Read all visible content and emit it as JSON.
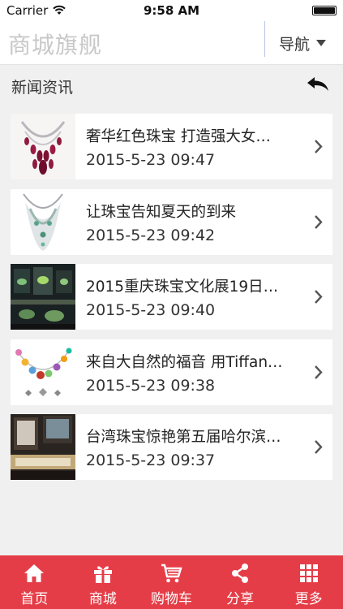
{
  "status_bar": {
    "carrier": "Carrier",
    "time": "9:58 AM"
  },
  "header": {
    "title": "商城旗舰",
    "menu_label": "导航"
  },
  "section": {
    "title": "新闻资讯"
  },
  "news": [
    {
      "title": "奢华红色珠宝 打造强大女…",
      "date": "2015-5-23 09:47",
      "thumb": "ruby-necklace"
    },
    {
      "title": "让珠宝告知夏天的到来",
      "date": "2015-5-23 09:42",
      "thumb": "diamond-necklace"
    },
    {
      "title": "2015重庆珠宝文化展19日…",
      "date": "2015-5-23 09:40",
      "thumb": "jewelry-exhibition"
    },
    {
      "title": "来自大自然的福音 用Tiffan…",
      "date": "2015-5-23 09:38",
      "thumb": "gemstone-necklace"
    },
    {
      "title": "台湾珠宝惊艳第五届哈尔滨…",
      "date": "2015-5-23 09:37",
      "thumb": "jewelry-showcase"
    }
  ],
  "tabs": [
    {
      "label": "首页",
      "icon": "home-icon"
    },
    {
      "label": "商城",
      "icon": "gift-icon"
    },
    {
      "label": "购物车",
      "icon": "cart-icon"
    },
    {
      "label": "分享",
      "icon": "share-icon"
    },
    {
      "label": "更多",
      "icon": "grid-icon"
    }
  ],
  "colors": {
    "tabbar": "#e53d47",
    "page_bg": "#f0f0f0",
    "title_gray": "#c8c8c8"
  }
}
